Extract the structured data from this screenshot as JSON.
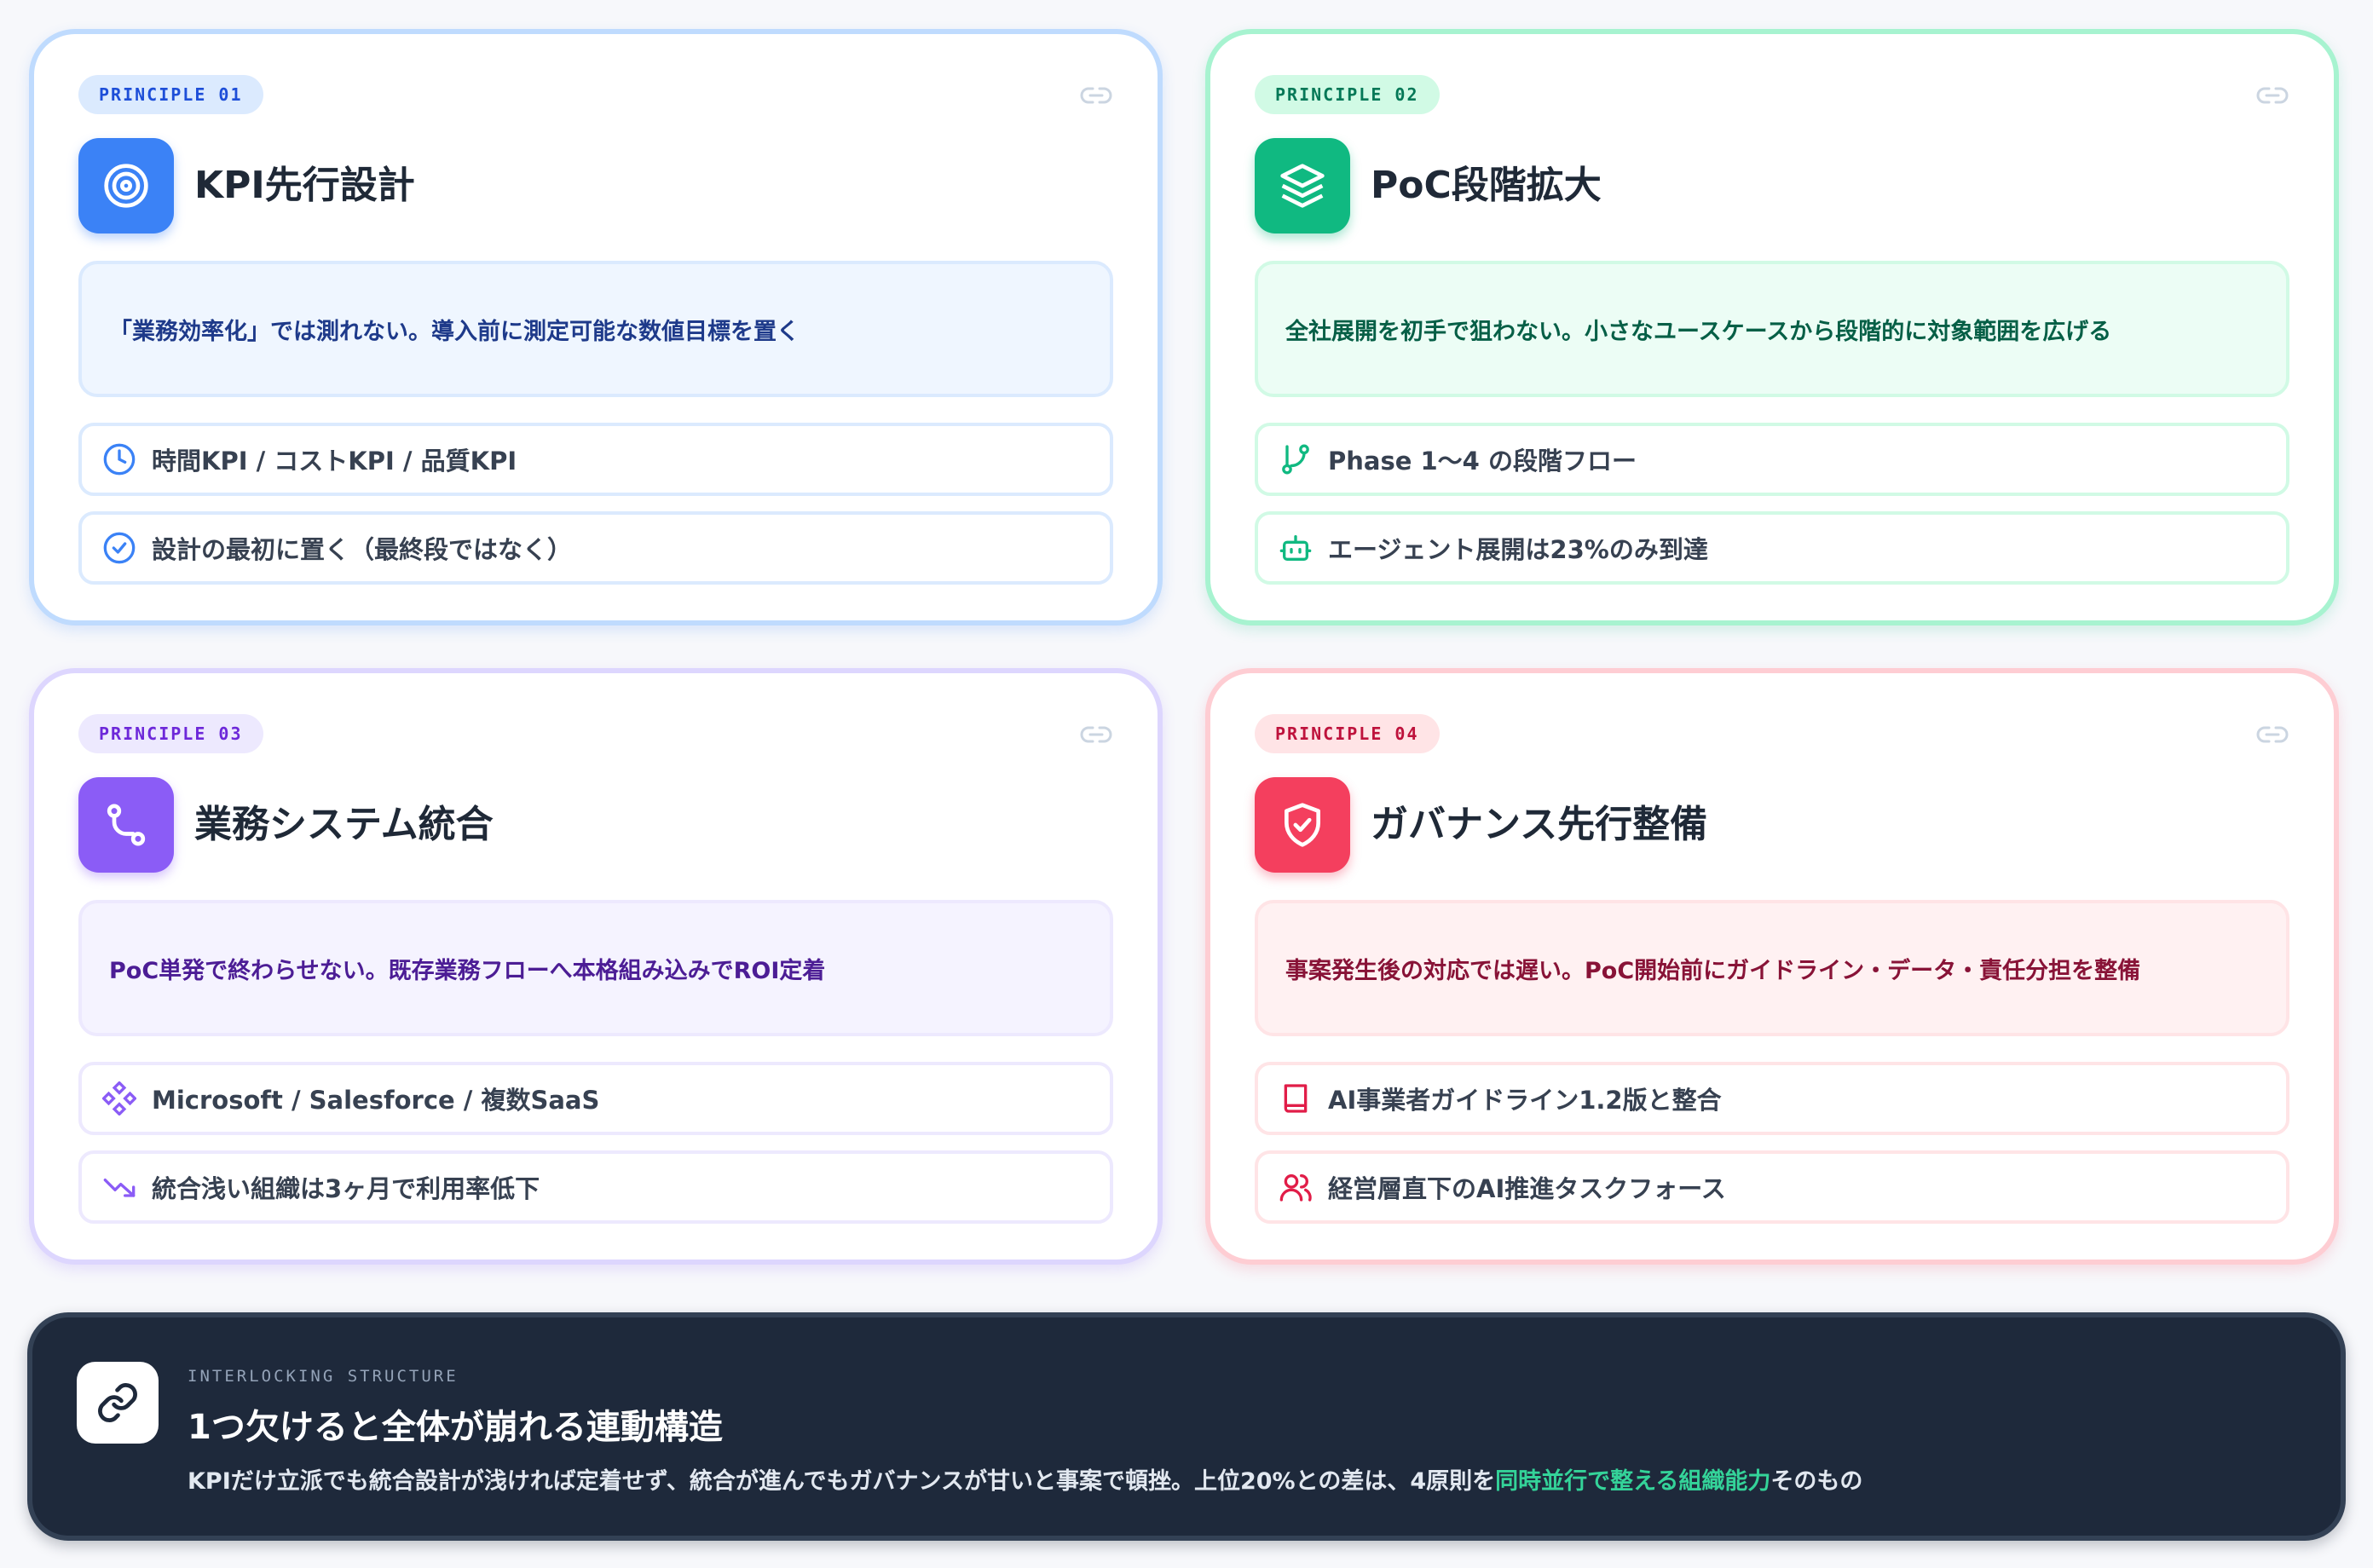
{
  "principles": [
    {
      "badge": "PRINCIPLE 01",
      "title": "KPI先行設計",
      "description": "「業務効率化」では測れない。導入前に測定可能な数値目標を置く",
      "items": [
        "時間KPI / コストKPI / 品質KPI",
        "設計の最初に置く（最終段ではなく）"
      ],
      "icons": [
        "target-icon",
        "clock-icon",
        "check-circle-icon"
      ],
      "accent": "#3b82f6"
    },
    {
      "badge": "PRINCIPLE 02",
      "title": "PoC段階拡大",
      "description": "全社展開を初手で狙わない。小さなユースケースから段階的に対象範囲を広げる",
      "items": [
        "Phase 1〜4 の段階フロー",
        "エージェント展開は23%のみ到達"
      ],
      "icons": [
        "layers-icon",
        "git-branch-icon",
        "bot-icon"
      ],
      "accent": "#10b981"
    },
    {
      "badge": "PRINCIPLE 03",
      "title": "業務システム統合",
      "description": "PoC単発で終わらせない。既存業務フローへ本格組み込みでROI定着",
      "items": [
        "Microsoft / Salesforce / 複数SaaS",
        "統合浅い組織は3ヶ月で利用率低下"
      ],
      "icons": [
        "route-icon",
        "integration-icon",
        "trending-down-icon"
      ],
      "accent": "#8b5cf6"
    },
    {
      "badge": "PRINCIPLE 04",
      "title": "ガバナンス先行整備",
      "description": "事案発生後の対応では遅い。PoC開始前にガイドライン・データ・責任分担を整備",
      "items": [
        "AI事業者ガイドライン1.2版と整合",
        "経営層直下のAI推進タスクフォース"
      ],
      "icons": [
        "shield-check-icon",
        "book-icon",
        "users-icon"
      ],
      "accent": "#f43f5e"
    }
  ],
  "footer": {
    "eyebrow": "INTERLOCKING STRUCTURE",
    "title": "1つ欠けると全体が崩れる連動構造",
    "body_before": "KPIだけ立派でも統合設計が浅ければ定着せず、統合が進んでもガバナンスが甘いと事案で頓挫。上位20%との差は、4原則を",
    "body_highlight": "同時並行で整える組織能力",
    "body_after": "そのもの",
    "highlight_color": "#34d399",
    "icon": "link-icon"
  }
}
